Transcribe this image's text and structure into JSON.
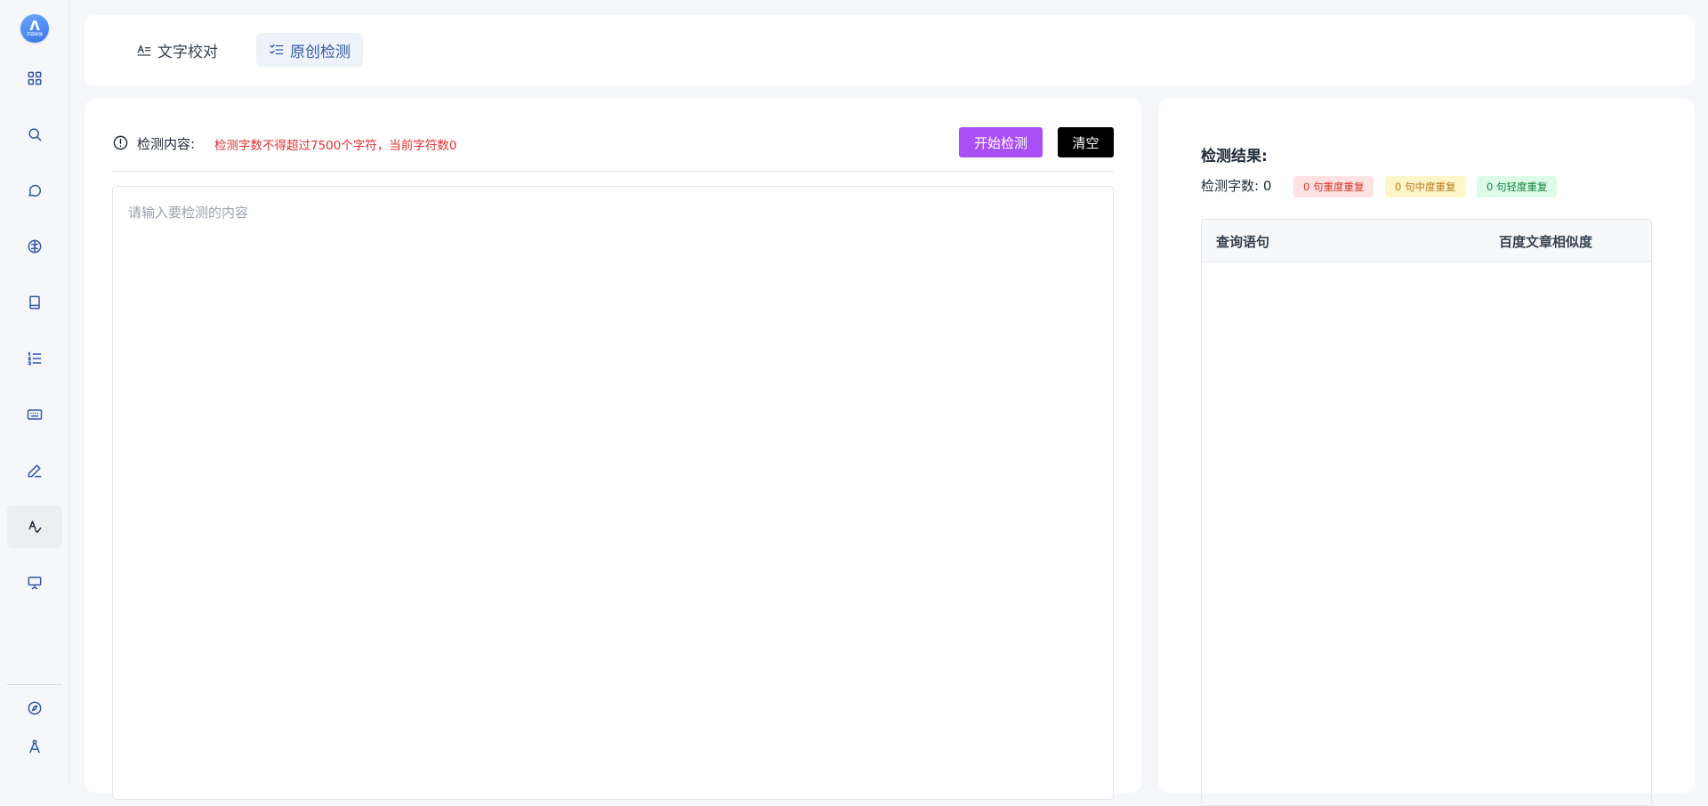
{
  "sidebar": {
    "logo_mark": "Λ",
    "logo_text": "开辟探微",
    "items": [
      {
        "icon": "grid-icon"
      },
      {
        "icon": "search-icon"
      },
      {
        "icon": "chat-icon"
      },
      {
        "icon": "brain-icon"
      },
      {
        "icon": "book-icon"
      },
      {
        "icon": "list-ordered-icon"
      },
      {
        "icon": "keyboard-icon"
      },
      {
        "icon": "pen-icon"
      },
      {
        "icon": "spellcheck-icon",
        "active": true
      },
      {
        "icon": "presentation-icon"
      }
    ],
    "bottom_items": [
      {
        "icon": "compass-icon"
      },
      {
        "icon": "drafting-compass-icon"
      }
    ]
  },
  "tabs": [
    {
      "label": "文字校对",
      "icon": "text-proofread-icon",
      "active": false
    },
    {
      "label": "原创检测",
      "icon": "checklist-icon",
      "active": true
    }
  ],
  "detect": {
    "content_label": "检测内容:",
    "warning": "检测字数不得超过7500个字符，当前字符数0",
    "start_button": "开始检测",
    "clear_button": "清空",
    "placeholder": "请输入要检测的内容"
  },
  "result": {
    "title": "检测结果:",
    "count_label": "检测字数: 0",
    "tags": {
      "heavy": "0 句重度重复",
      "mid": "0 句中度重复",
      "light": "0 句轻度重复"
    },
    "columns": {
      "query": "查询语句",
      "similarity": "百度文章相似度"
    }
  },
  "colors": {
    "accent_purple": "#a84ff5",
    "warning_red": "#e03131",
    "nav_blue": "#3457a8"
  }
}
